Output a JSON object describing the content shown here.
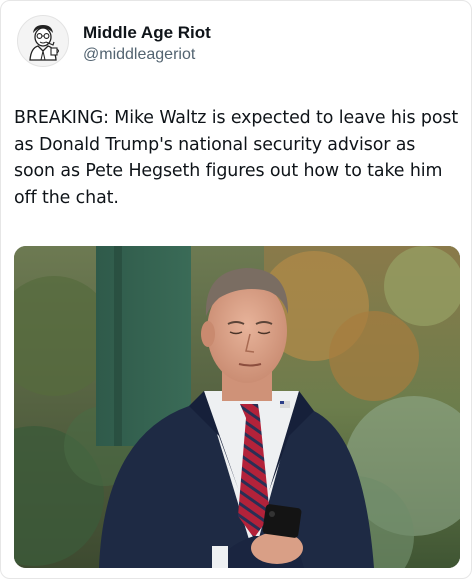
{
  "post": {
    "author": {
      "display_name": "Middle Age Riot",
      "handle": "@middleageriot",
      "avatar_icon": "cartoon-man-portrait-icon"
    },
    "text": "BREAKING: Mike Waltz is expected to leave his post as Donald Trump's national security advisor as soon as Pete Hegseth figures out how to take him off the chat.",
    "media": {
      "type": "photo",
      "subject": "man-in-suit-looking-at-phone"
    }
  },
  "colors": {
    "text_primary": "#0f1419",
    "text_secondary": "#536471",
    "suit": "#1e2a44",
    "tie_red": "#b3223a"
  }
}
